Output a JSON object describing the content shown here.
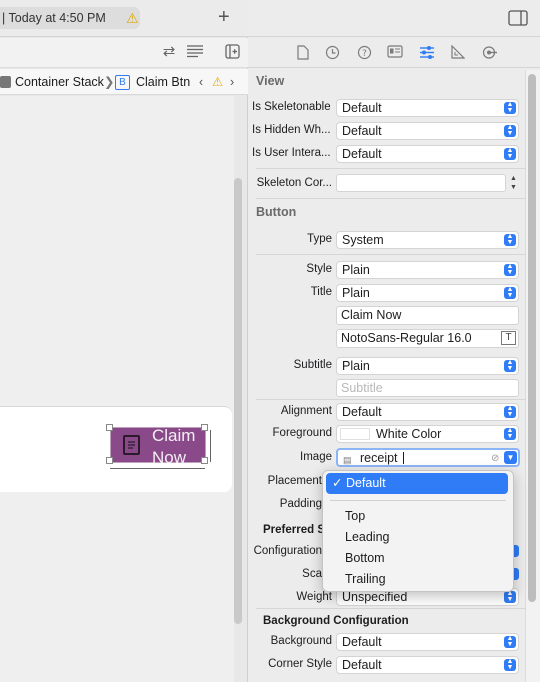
{
  "activity": {
    "text": "| Today at 4:50 PM"
  },
  "jumpbar": {
    "item1": "Container Stack",
    "item2_badge": "B",
    "item2": "Claim Btn"
  },
  "canvas": {
    "button_text": "Claim Now"
  },
  "inspector": {
    "view_section": "View",
    "is_skeletonable": {
      "label": "Is Skeletonable",
      "value": "Default"
    },
    "is_hidden": {
      "label": "Is Hidden Wh...",
      "value": "Default"
    },
    "is_user_interaction": {
      "label": "Is User Intera...",
      "value": "Default"
    },
    "skeleton_corner": {
      "label": "Skeleton Cor...",
      "value": ""
    },
    "button_section": "Button",
    "type": {
      "label": "Type",
      "value": "System"
    },
    "style": {
      "label": "Style",
      "value": "Plain"
    },
    "title": {
      "label": "Title",
      "value": "Plain",
      "text": "Claim Now",
      "font": "NotoSans-Regular 16.0"
    },
    "subtitle": {
      "label": "Subtitle",
      "value": "Plain",
      "placeholder": "Subtitle"
    },
    "alignment": {
      "label": "Alignment",
      "value": "Default"
    },
    "foreground": {
      "label": "Foreground",
      "value": "White Color"
    },
    "image": {
      "label": "Image",
      "value": "receipt"
    },
    "placement": {
      "label": "Placement"
    },
    "padding": {
      "label": "Padding"
    },
    "preferred_section": "Preferred S",
    "configuration": {
      "label": "Configuration"
    },
    "scale": {
      "label": "Sca"
    },
    "weight": {
      "label": "Weight",
      "value": "Unspecified"
    },
    "background_config_section": "Background Configuration",
    "background": {
      "label": "Background",
      "value": "Default"
    },
    "corner_style": {
      "label": "Corner Style",
      "value": "Default"
    }
  },
  "placement_menu": {
    "selected": "✓ Default",
    "items": [
      "Top",
      "Leading",
      "Bottom",
      "Trailing"
    ]
  },
  "colors": {
    "accent": "#2f7cf6",
    "button_bg": "#8a4a89",
    "warning": "#e0a800"
  }
}
